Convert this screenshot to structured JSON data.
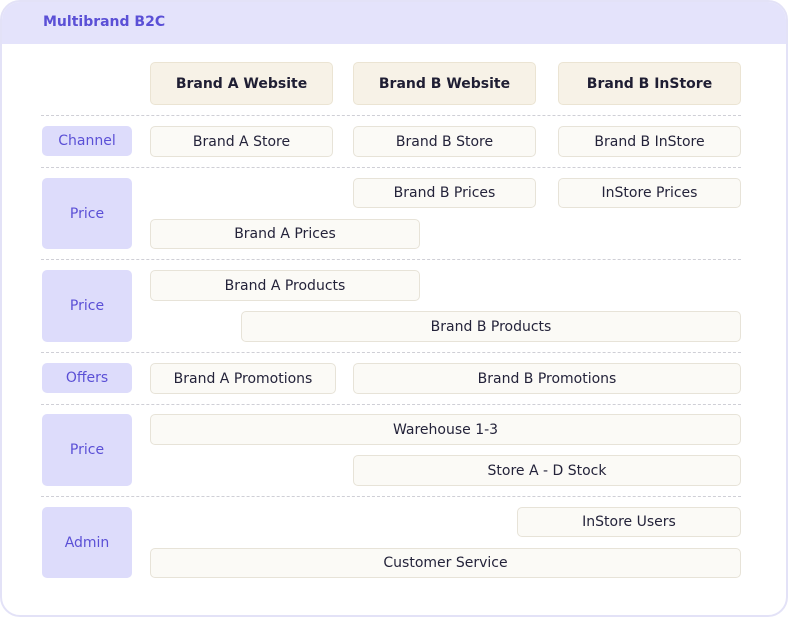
{
  "title": "Multibrand B2C",
  "columns": [
    "Brand A Website",
    "Brand B Website",
    "Brand B InStore"
  ],
  "rows": {
    "channel": {
      "label": "Channel",
      "items": [
        "Brand A Store",
        "Brand B Store",
        "Brand B InStore"
      ]
    },
    "price1": {
      "label": "Price",
      "items": [
        "Brand B Prices",
        "InStore Prices",
        "Brand A Prices"
      ]
    },
    "price2": {
      "label": "Price",
      "items": [
        "Brand A Products",
        "Brand B Products"
      ]
    },
    "offers": {
      "label": "Offers",
      "items": [
        "Brand A Promotions",
        "Brand B Promotions"
      ]
    },
    "price3": {
      "label": "Price",
      "items": [
        "Warehouse 1-3",
        "Store A - D Stock"
      ]
    },
    "admin": {
      "label": "Admin",
      "items": [
        "InStore Users",
        "Customer Service"
      ]
    }
  }
}
